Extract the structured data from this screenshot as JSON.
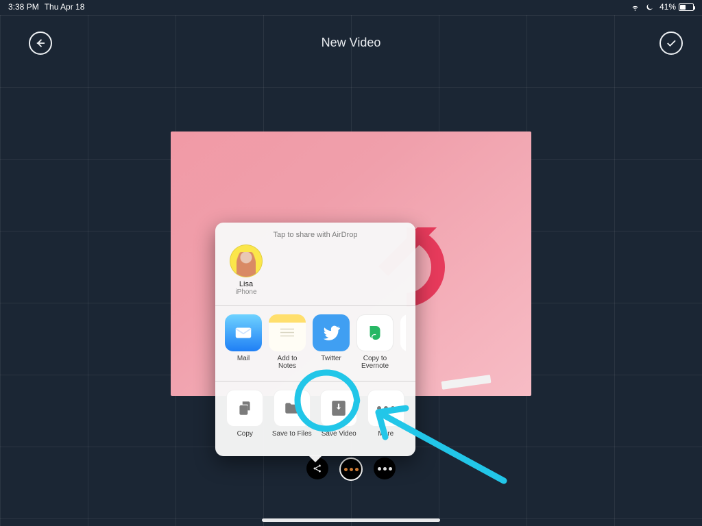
{
  "status": {
    "time": "3:38 PM",
    "date": "Thu Apr 18",
    "battery_pct": "41%"
  },
  "nav": {
    "title": "New Video"
  },
  "share": {
    "airdrop_header": "Tap to share with AirDrop",
    "airdrop": [
      {
        "name": "Lisa",
        "device": "iPhone"
      }
    ],
    "apps": [
      {
        "label": "Mail"
      },
      {
        "label": "Add to Notes"
      },
      {
        "label": "Twitter"
      },
      {
        "label": "Copy to Evernote"
      }
    ],
    "actions": [
      {
        "label": "Copy"
      },
      {
        "label": "Save to Files"
      },
      {
        "label": "Save Video"
      },
      {
        "label": "More"
      }
    ]
  },
  "annotation_color": "#22c6e8"
}
